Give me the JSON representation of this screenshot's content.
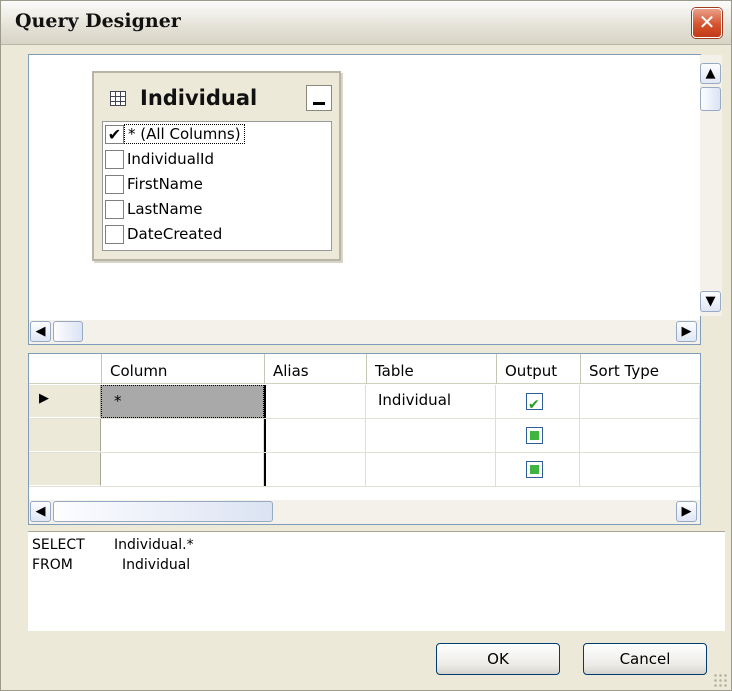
{
  "window": {
    "title": "Query Designer",
    "close_glyph": "✕"
  },
  "diagram": {
    "table_name": "Individual",
    "columns": [
      {
        "label": "* (All Columns)",
        "checked": true
      },
      {
        "label": "IndividualId",
        "checked": false
      },
      {
        "label": "FirstName",
        "checked": false
      },
      {
        "label": "LastName",
        "checked": false
      },
      {
        "label": "DateCreated",
        "checked": false
      }
    ],
    "check_glyph": "✔"
  },
  "grid": {
    "headers": {
      "column": "Column",
      "alias": "Alias",
      "table": "Table",
      "output": "Output",
      "sort_type": "Sort Type"
    },
    "rows": [
      {
        "indicator": "▶",
        "column": "*",
        "alias": "",
        "table": "Individual",
        "output": "checked"
      },
      {
        "indicator": "",
        "column": "",
        "alias": "",
        "table": "",
        "output": "indeterminate"
      },
      {
        "indicator": "",
        "column": "",
        "alias": "",
        "table": "",
        "output": "indeterminate"
      }
    ]
  },
  "sql": {
    "select_kw": "SELECT",
    "select_val": "Individual.*",
    "from_kw": "FROM",
    "from_val": "Individual"
  },
  "buttons": {
    "ok": "OK",
    "cancel": "Cancel"
  },
  "scroll_glyphs": {
    "up": "▲",
    "down": "▼",
    "left": "◀",
    "right": "▶",
    "grip": "≡",
    "hgrip": "⦀"
  },
  "colors": {
    "checkbox_green": "#21a121",
    "close_red": "#d5542e",
    "pane_border": "#7f9db9"
  }
}
